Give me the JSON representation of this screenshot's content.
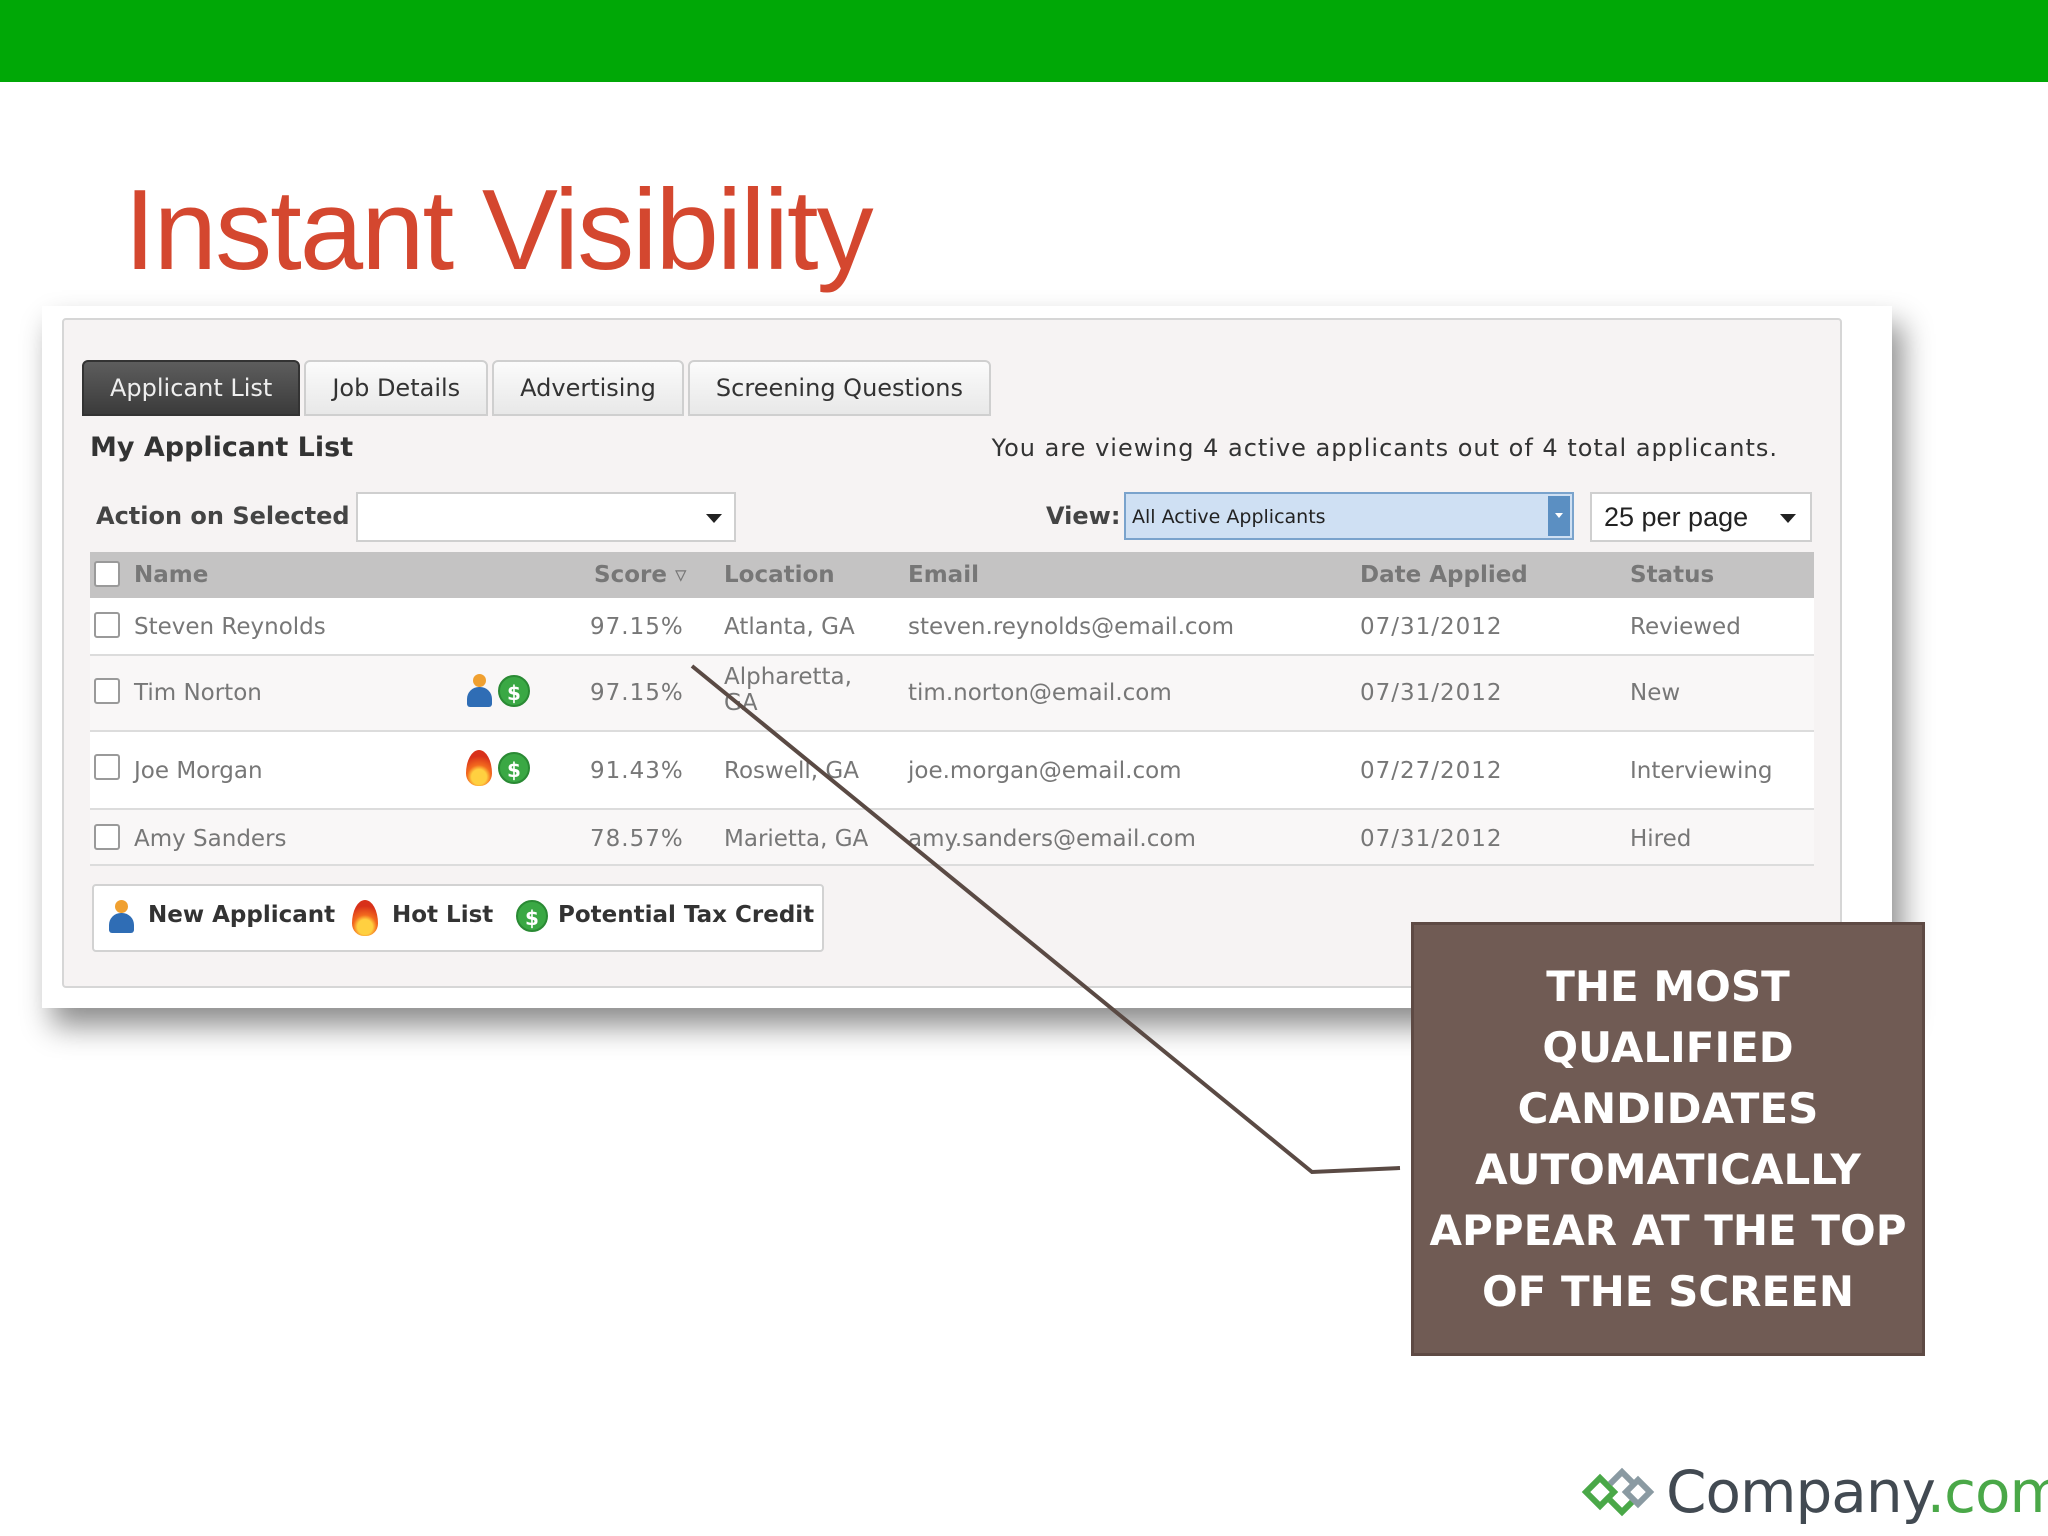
{
  "slide": {
    "title": "Instant Visibility",
    "callout": "THE MOST QUALIFIED CANDIDATES AUTOMATICALLY APPEAR AT THE TOP OF THE SCREEN",
    "brand_name": "Company",
    "brand_tld": ".com",
    "colors": {
      "top_bar": "#00a806",
      "title": "#d4472f",
      "callout_bg": "#705b54",
      "brand_accent": "#4aa848"
    }
  },
  "tabs": [
    {
      "label": "Applicant List",
      "active": true
    },
    {
      "label": "Job Details",
      "active": false
    },
    {
      "label": "Advertising",
      "active": false
    },
    {
      "label": "Screening Questions",
      "active": false
    }
  ],
  "list": {
    "title": "My Applicant List",
    "summary": "You are viewing 4 active applicants out of 4 total applicants."
  },
  "controls": {
    "action_label": "Action on Selected",
    "action_value": "",
    "view_label": "View:",
    "view_value": "All Active Applicants",
    "per_page": "25 per page"
  },
  "grid": {
    "columns": {
      "name": "Name",
      "score": "Score",
      "location": "Location",
      "email": "Email",
      "date": "Date Applied",
      "status": "Status"
    },
    "rows": [
      {
        "name": "Steven Reynolds",
        "icons": [],
        "score": "97.15%",
        "location": "Atlanta, GA",
        "location2": "",
        "email": "steven.reynolds@email.com",
        "date": "07/31/2012",
        "status": "Reviewed"
      },
      {
        "name": "Tim Norton",
        "icons": [
          "new-applicant-icon",
          "tax-credit-icon"
        ],
        "score": "97.15%",
        "location": "Alpharetta,",
        "location2": "GA",
        "email": "tim.norton@email.com",
        "date": "07/31/2012",
        "status": "New"
      },
      {
        "name": "Joe Morgan",
        "icons": [
          "hot-list-icon",
          "tax-credit-icon"
        ],
        "score": "91.43%",
        "location": "Roswell, GA",
        "location2": "",
        "email": "joe.morgan@email.com",
        "date": "07/27/2012",
        "status": "Interviewing"
      },
      {
        "name": "Amy Sanders",
        "icons": [],
        "score": "78.57%",
        "location": "Marietta, GA",
        "location2": "",
        "email": "amy.sanders@email.com",
        "date": "07/31/2012",
        "status": "Hired"
      }
    ]
  },
  "legend": {
    "new_applicant": "New Applicant",
    "hot_list": "Hot List",
    "tax_credit": "Potential Tax Credit"
  }
}
